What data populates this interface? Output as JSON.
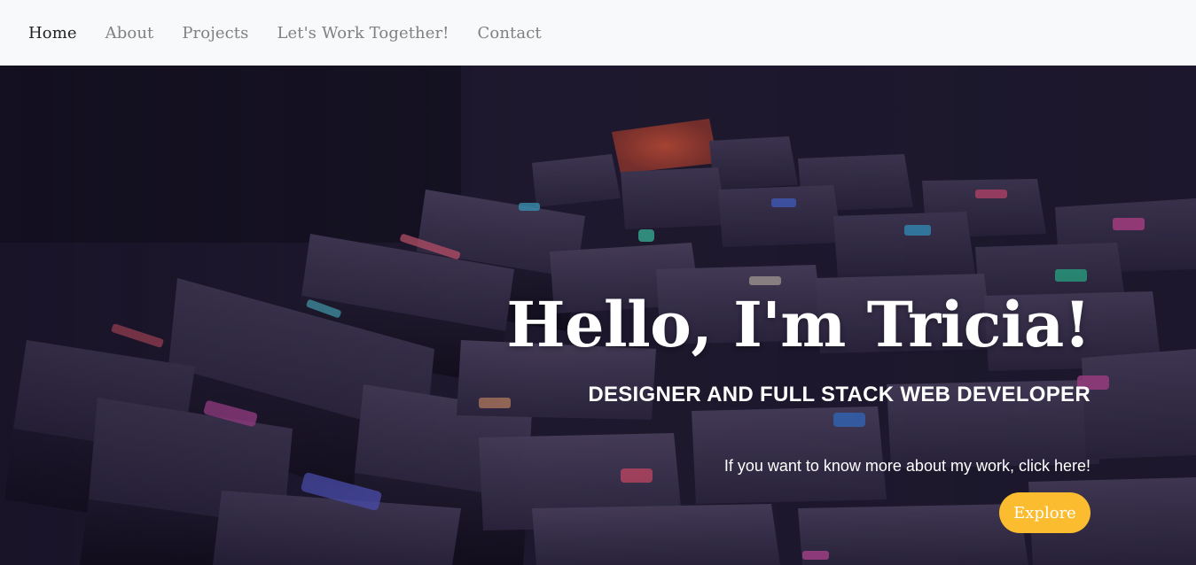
{
  "nav": {
    "items": [
      {
        "label": "Home",
        "active": true
      },
      {
        "label": "About",
        "active": false
      },
      {
        "label": "Projects",
        "active": false
      },
      {
        "label": "Let's Work Together!",
        "active": false
      },
      {
        "label": "Contact",
        "active": false
      }
    ]
  },
  "hero": {
    "title": "Hello, I'm Tricia!",
    "subtitle": "DESIGNER AND FULL STACK WEB DEVELOPER",
    "text": "If you want to know more about my work, click here!",
    "button_label": "Explore",
    "button_color": "#fbbd2f",
    "background_image": "keyboard-closeup"
  }
}
